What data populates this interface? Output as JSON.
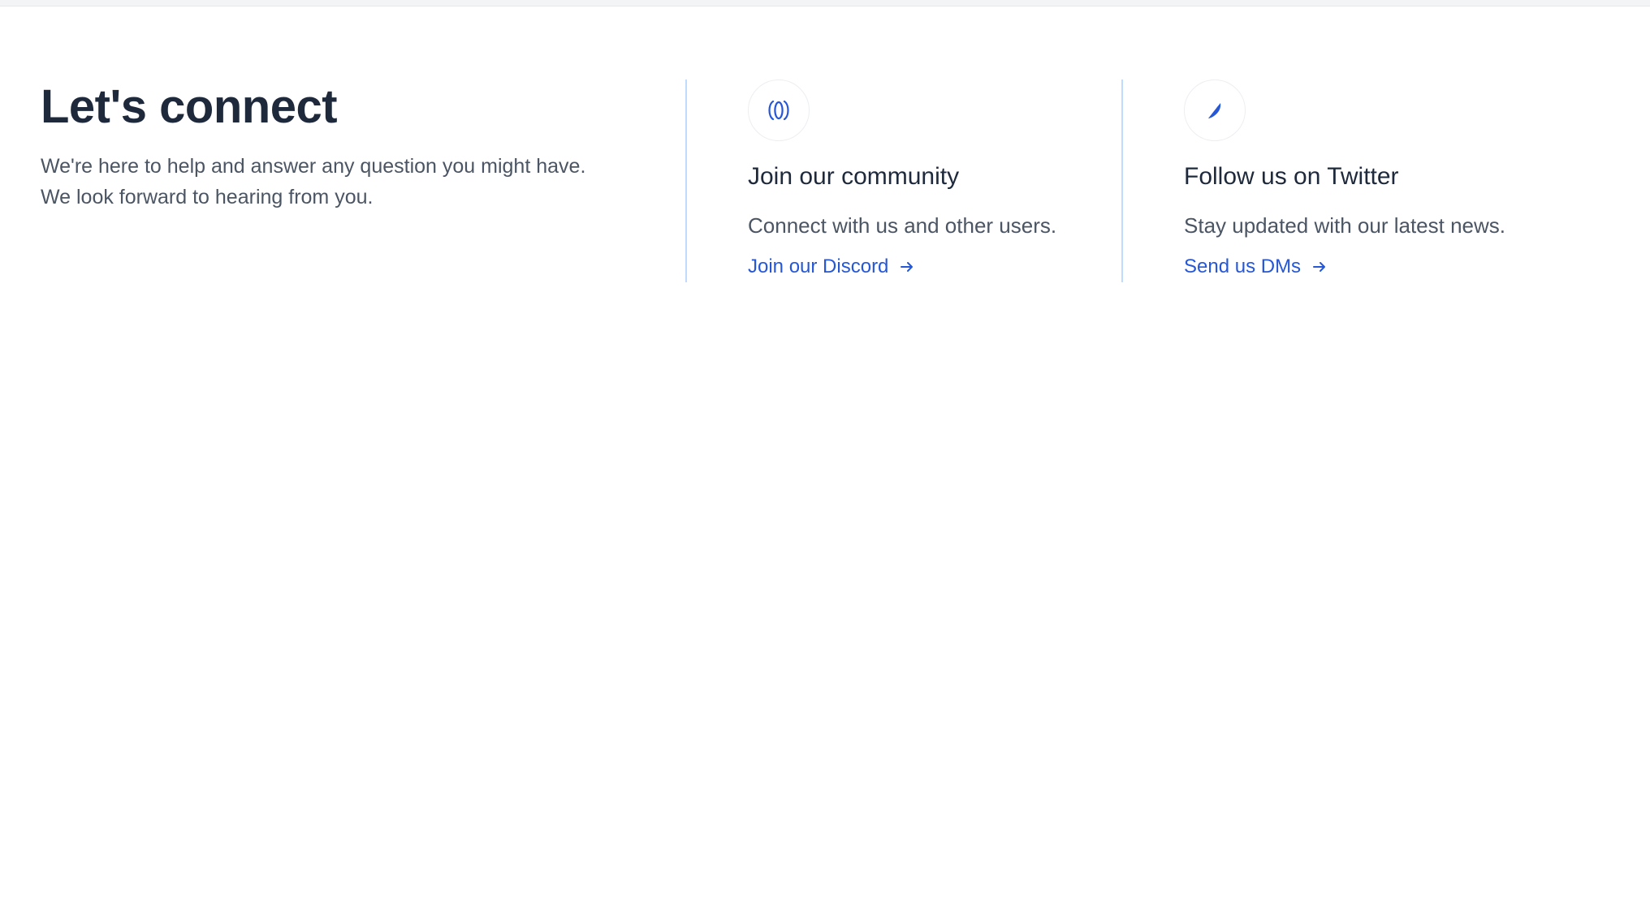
{
  "intro": {
    "title": "Let's connect",
    "lead_line_1": "We're here to help and answer any question you might have.",
    "lead_line_2": "We look forward to hearing from you."
  },
  "cards": [
    {
      "icon": "discord-icon",
      "title": "Join our community",
      "description": "Connect with us and other users.",
      "link_label": "Join our Discord"
    },
    {
      "icon": "feather-icon",
      "title": "Follow us on Twitter",
      "description": "Stay updated with our latest news.",
      "link_label": "Send us DMs"
    }
  ],
  "colors": {
    "accent": "#2557d6",
    "heading": "#1e293b",
    "body_text": "#4b5563",
    "divider": "#bfdbfe"
  }
}
